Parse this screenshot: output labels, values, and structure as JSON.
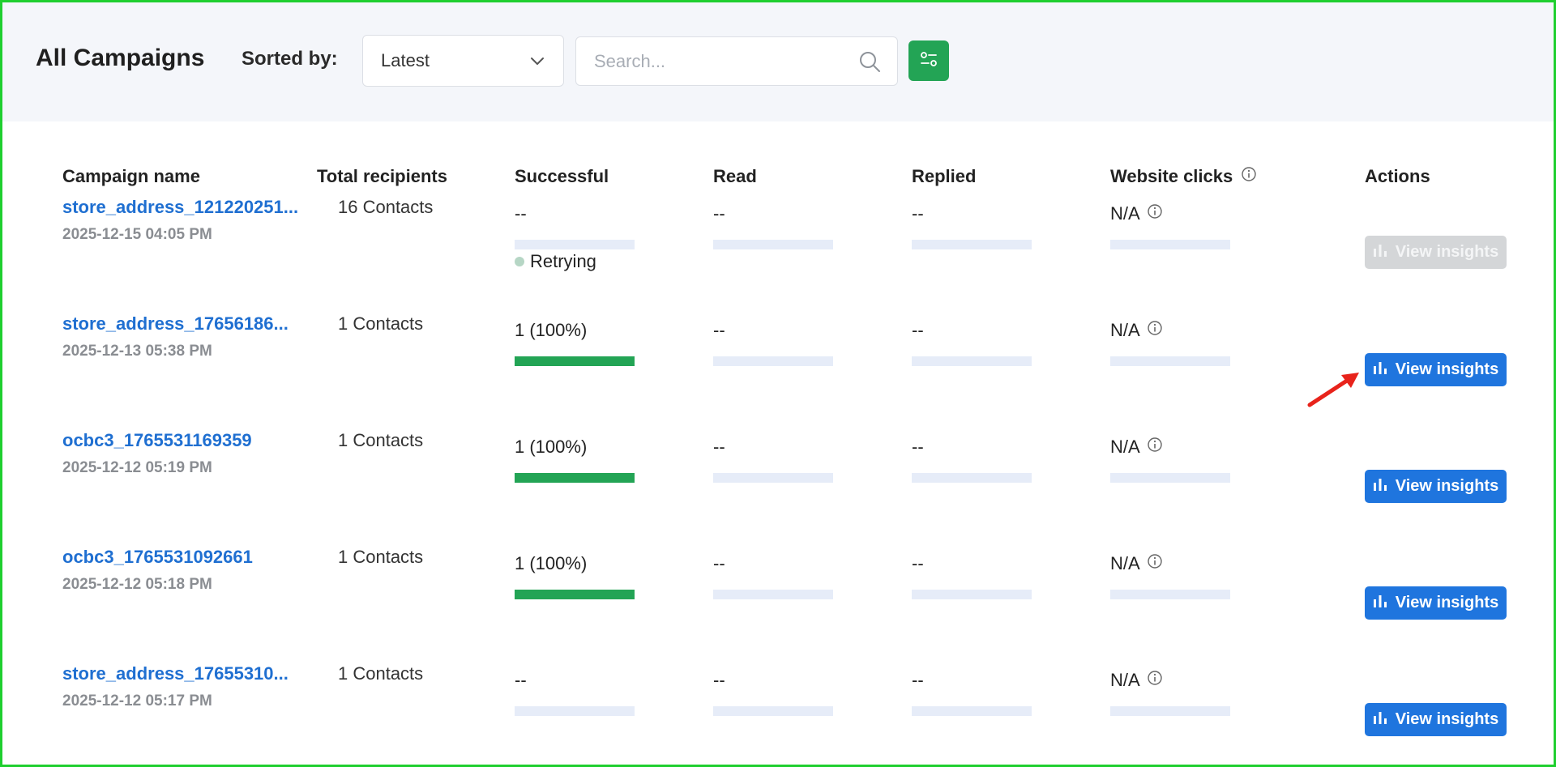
{
  "header": {
    "title": "All Campaigns",
    "sorted_label": "Sorted by:",
    "sort_value": "Latest",
    "search_placeholder": "Search..."
  },
  "columns": {
    "campaign_name": "Campaign name",
    "total_recipients": "Total recipients",
    "successful": "Successful",
    "read": "Read",
    "replied": "Replied",
    "website_clicks": "Website clicks",
    "actions": "Actions"
  },
  "rows": [
    {
      "name": "store_address_121220251...",
      "date": "2025-12-15 04:05 PM",
      "recipients": "16 Contacts",
      "successful": "--",
      "successful_fill": 0,
      "status": "Retrying",
      "read": "--",
      "replied": "--",
      "clicks": "N/A",
      "action": "View insights",
      "action_enabled": false
    },
    {
      "name": "store_address_17656186...",
      "date": "2025-12-13 05:38 PM",
      "recipients": "1 Contacts",
      "successful": "1 (100%)",
      "successful_fill": 1,
      "read": "--",
      "replied": "--",
      "clicks": "N/A",
      "action": "View insights",
      "action_enabled": true
    },
    {
      "name": "ocbc3_1765531169359",
      "date": "2025-12-12 05:19 PM",
      "recipients": "1 Contacts",
      "successful": "1 (100%)",
      "successful_fill": 1,
      "read": "--",
      "replied": "--",
      "clicks": "N/A",
      "action": "View insights",
      "action_enabled": true
    },
    {
      "name": "ocbc3_1765531092661",
      "date": "2025-12-12 05:18 PM",
      "recipients": "1 Contacts",
      "successful": "1 (100%)",
      "successful_fill": 1,
      "read": "--",
      "replied": "--",
      "clicks": "N/A",
      "action": "View insights",
      "action_enabled": true
    },
    {
      "name": "store_address_17655310...",
      "date": "2025-12-12 05:17 PM",
      "recipients": "1 Contacts",
      "successful": "--",
      "successful_fill": 0,
      "read": "--",
      "replied": "--",
      "clicks": "N/A",
      "action": "View insights",
      "action_enabled": true
    }
  ],
  "colors": {
    "accent_blue": "#1f75de",
    "link_blue": "#1f6fd1",
    "success_green": "#23a455",
    "bar_track": "#e6ecf8",
    "annotation_arrow": "#e8231b"
  },
  "icons": [
    "chevron-down-icon",
    "search-icon",
    "filter-settings-icon",
    "info-icon",
    "bar-chart-icon",
    "annotation-arrow"
  ]
}
